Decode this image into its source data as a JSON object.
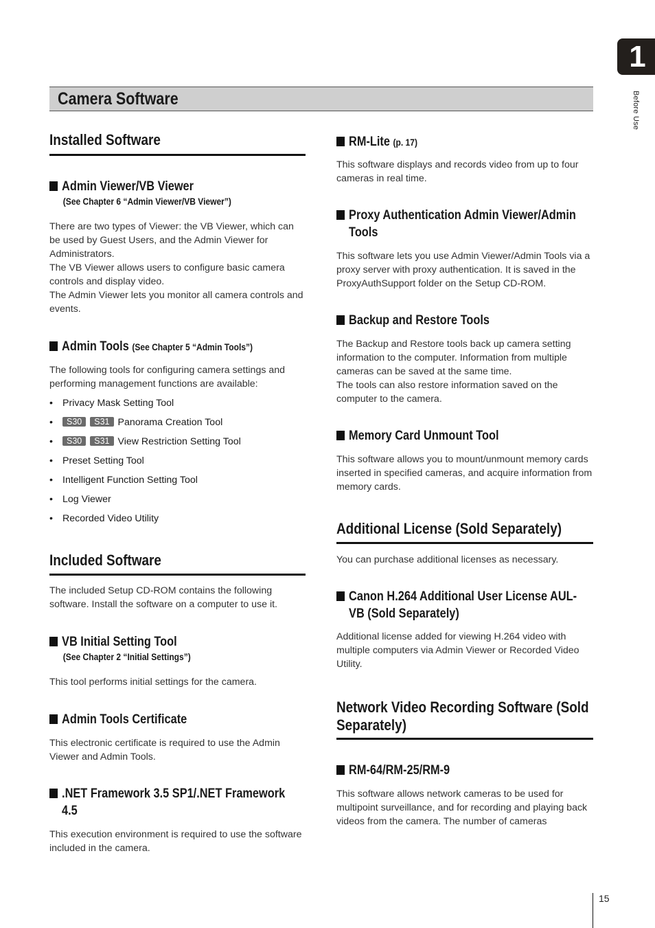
{
  "chapter": {
    "number": "1",
    "label": "Before Use"
  },
  "page_title": "Camera Software",
  "page_number": "15",
  "left": {
    "installed": {
      "heading": "Installed Software",
      "admin_viewer": {
        "title": "Admin Viewer/VB Viewer",
        "ref": "(See Chapter 6 “Admin Viewer/VB Viewer”)",
        "paragraphs": [
          "There are two types of Viewer: the VB Viewer, which can be used by Guest Users, and the Admin Viewer for Administrators.",
          "The VB Viewer allows users to configure basic camera controls and display video.",
          "The Admin Viewer lets you monitor all camera controls and events."
        ]
      },
      "admin_tools": {
        "title": "Admin Tools",
        "ref": "(See Chapter 5 “Admin Tools”)",
        "intro": "The following tools for configuring camera settings and performing management functions are available:",
        "bullet": "•",
        "items": [
          {
            "label": "Privacy Mask Setting Tool",
            "badges": []
          },
          {
            "label": "Panorama Creation Tool",
            "badges": [
              "S30",
              "S31"
            ]
          },
          {
            "label": "View Restriction Setting Tool",
            "badges": [
              "S30",
              "S31"
            ]
          },
          {
            "label": "Preset Setting Tool",
            "badges": []
          },
          {
            "label": "Intelligent Function Setting Tool",
            "badges": []
          },
          {
            "label": "Log Viewer",
            "badges": []
          },
          {
            "label": "Recorded Video Utility",
            "badges": []
          }
        ]
      }
    },
    "included": {
      "heading": "Included Software",
      "intro": "The included Setup CD-ROM contains the following software. Install the software on a computer to use it.",
      "vb_initial": {
        "title": "VB Initial Setting Tool",
        "ref": "(See Chapter 2 “Initial Settings”)",
        "body": "This tool performs initial settings for the camera."
      },
      "certificate": {
        "title": "Admin Tools Certificate",
        "body": "This electronic certificate is required to use the Admin Viewer and Admin Tools."
      },
      "dotnet": {
        "title_line1": ".NET Framework 3.5 SP1/.NET Framework",
        "title_line2": "4.5",
        "body": "This execution environment is required to use the software included in the camera."
      }
    }
  },
  "right": {
    "rm_lite": {
      "title": "RM-Lite",
      "ref": "(p. 17)",
      "body": "This software displays and records video from up to four cameras in real time."
    },
    "proxy": {
      "title_line1": "Proxy Authentication Admin Viewer/Admin",
      "title_line2": "Tools",
      "body": "This software lets you use Admin Viewer/Admin Tools via a proxy server with proxy authentication. It is saved in the ProxyAuthSupport folder on the Setup CD-ROM."
    },
    "backup": {
      "title": "Backup and Restore Tools",
      "paragraphs": [
        "The Backup and Restore tools back up camera setting information to the computer. Information from multiple cameras can be saved at the same time.",
        "The tools can also restore information saved on the computer to the camera."
      ]
    },
    "memory_card": {
      "title": "Memory Card Unmount Tool",
      "body": "This software allows you to mount/unmount memory cards inserted in specified cameras, and acquire information from memory cards."
    },
    "additional_license": {
      "heading": "Additional License (Sold Separately)",
      "intro": "You can purchase additional licenses as necessary.",
      "aul": {
        "title_line1": "Canon H.264 Additional User License AUL-",
        "title_line2": "VB (Sold Separately)",
        "body": "Additional license added for viewing H.264 video with multiple computers via Admin Viewer or Recorded Video Utility."
      }
    },
    "nvr": {
      "heading_line1": "Network Video Recording Software (Sold",
      "heading_line2": "Separately)",
      "rm": {
        "title": "RM-64/RM-25/RM-9",
        "body": "This software allows network cameras to be used for multipoint surveillance, and for recording and playing back videos from the camera. The number of cameras"
      }
    }
  }
}
